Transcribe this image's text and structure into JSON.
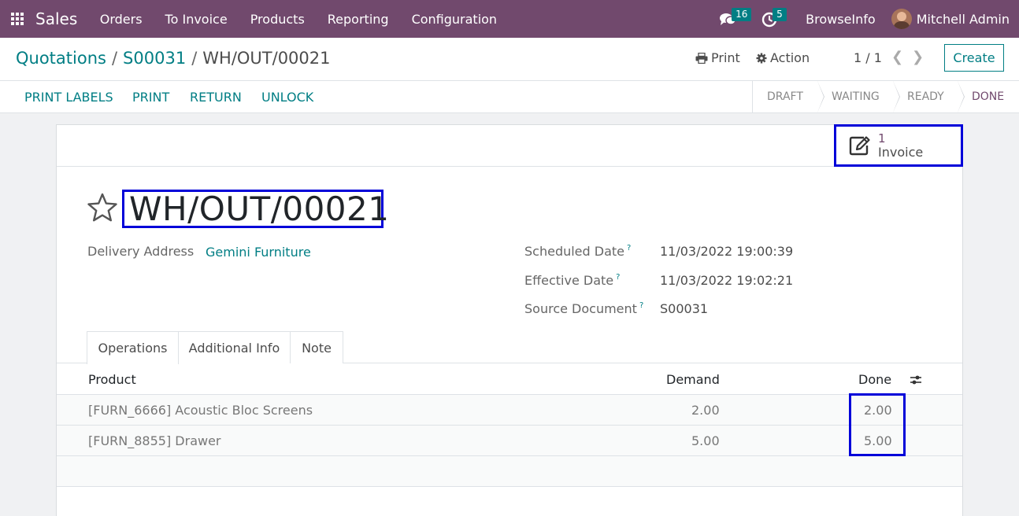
{
  "navbar": {
    "app_name": "Sales",
    "menu": [
      "Orders",
      "To Invoice",
      "Products",
      "Reporting",
      "Configuration"
    ],
    "messages_count": "16",
    "activities_count": "5",
    "company": "BrowseInfo",
    "user": "Mitchell Admin",
    "bg_color": "#71496d"
  },
  "breadcrumb": {
    "items": [
      "Quotations",
      "S00031"
    ],
    "current": "WH/OUT/00021"
  },
  "control": {
    "print_label": "Print",
    "action_label": "Action",
    "pager": "1 / 1",
    "create_label": "Create"
  },
  "statusbar": {
    "buttons": [
      "PRINT LABELS",
      "PRINT",
      "RETURN",
      "UNLOCK"
    ],
    "steps": [
      "DRAFT",
      "WAITING",
      "READY",
      "DONE"
    ],
    "active_step": "DONE"
  },
  "smart_button": {
    "count": "1",
    "label": "Invoice"
  },
  "record": {
    "name": "WH/OUT/00021",
    "delivery_address_label": "Delivery Address",
    "delivery_address": "Gemini Furniture",
    "scheduled_date_label": "Scheduled Date",
    "scheduled_date": "11/03/2022 19:00:39",
    "effective_date_label": "Effective Date",
    "effective_date": "11/03/2022 19:02:21",
    "source_document_label": "Source Document",
    "source_document": "S00031",
    "help_mark": "?"
  },
  "tabs": [
    "Operations",
    "Additional Info",
    "Note"
  ],
  "table": {
    "columns": [
      "Product",
      "Demand",
      "Done"
    ],
    "rows": [
      {
        "product": "[FURN_6666] Acoustic Bloc Screens",
        "demand": "2.00",
        "done": "2.00"
      },
      {
        "product": "[FURN_8855] Drawer",
        "demand": "5.00",
        "done": "5.00"
      }
    ]
  },
  "accent_color": "#017e84"
}
